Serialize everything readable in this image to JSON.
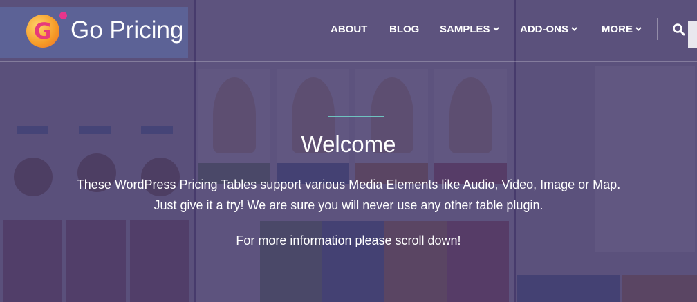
{
  "brand": {
    "name": "Go Pricing",
    "logo_letter": "G"
  },
  "nav": {
    "items": [
      {
        "label": "ABOUT",
        "dropdown": false
      },
      {
        "label": "BLOG",
        "dropdown": false
      },
      {
        "label": "SAMPLES",
        "dropdown": true
      },
      {
        "label": "ADD-ONS",
        "dropdown": true
      },
      {
        "label": "MORE",
        "dropdown": true
      }
    ],
    "chevron": "⌄",
    "search_icon": "search-icon"
  },
  "hero": {
    "title": "Welcome",
    "description_line1": "These WordPress Pricing Tables support various Media Elements like Audio, Video, Image or Map.",
    "description_line2": "Just give it a try! We are sure you will never use any other table plugin.",
    "more_info": "For more information please scroll down!"
  },
  "colors": {
    "overlay": "#423769",
    "accent_divider": "#6fc3c0",
    "logo_dot": "#e7358c"
  }
}
